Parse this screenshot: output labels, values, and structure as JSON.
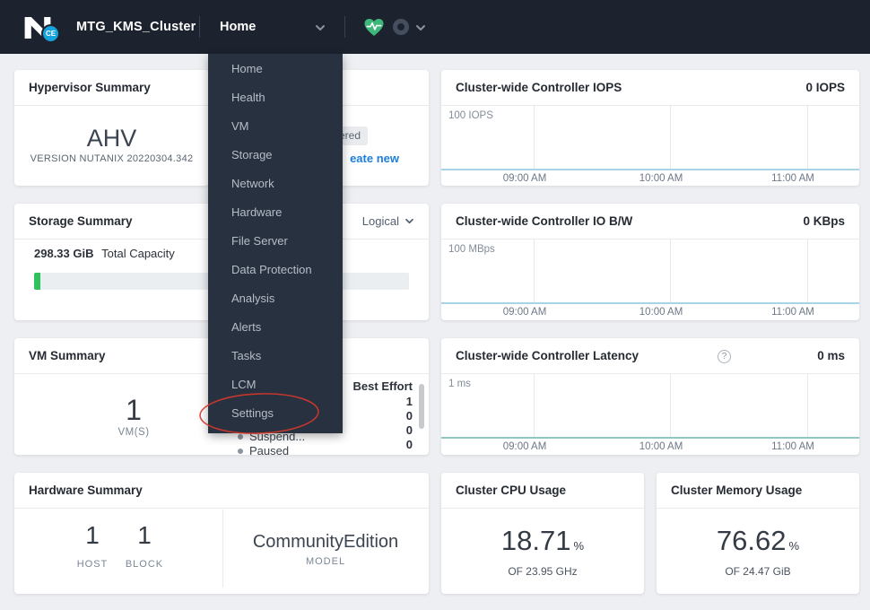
{
  "navbar": {
    "logo_badge": "CE",
    "cluster_name": "MTG_KMS_Cluster",
    "menu_label": "Home"
  },
  "menu": {
    "items": [
      "Home",
      "Health",
      "VM",
      "Storage",
      "Network",
      "Hardware",
      "File Server",
      "Data Protection",
      "Analysis",
      "Alerts",
      "Tasks",
      "LCM",
      "Settings"
    ]
  },
  "annotation": {
    "shape": "ellipse-around-settings",
    "color": "#d5382c"
  },
  "hypervisor": {
    "title": "Hypervisor Summary",
    "name": "AHV",
    "version": "VERSION NUTANIX 20220304.342"
  },
  "prism_central": {
    "badge_visible_fragment": "ered",
    "link_visible_fragment": "eate new",
    "link_color": "#1d7ed9"
  },
  "storage": {
    "title": "Storage Summary",
    "view_selector": "Logical",
    "total_capacity_value": "298.33 GiB",
    "total_capacity_label": "Total Capacity",
    "bar_fill_color": "#2fc15c"
  },
  "vm": {
    "title": "VM Summary",
    "count": "1",
    "count_label": "VM(S)",
    "legend_header": "Best Effort",
    "legend_values": [
      "1",
      "0",
      "0",
      "0"
    ],
    "visible_legend_labels": [
      "Suspend...",
      "Paused"
    ]
  },
  "hardware": {
    "title": "Hardware Summary",
    "host_count": "1",
    "host_label": "HOST",
    "block_count": "1",
    "block_label": "BLOCK",
    "model_name": "CommunityEdition",
    "model_label": "MODEL"
  },
  "cpu": {
    "title": "Cluster CPU Usage",
    "value": "18.71",
    "unit": "%",
    "subtitle": "OF 23.95 GHz"
  },
  "memory": {
    "title": "Cluster Memory Usage",
    "value": "76.62",
    "unit": "%",
    "subtitle": "OF 24.47 GiB"
  },
  "charts": {
    "iops": {
      "type": "line",
      "title": "Cluster-wide Controller IOPS",
      "current": "0 IOPS",
      "y_max": "100 IOPS",
      "x_ticks": [
        "09:00 AM",
        "10:00 AM",
        "11:00 AM"
      ],
      "series_value": 0,
      "line_color": "#a9d4e6"
    },
    "io_bw": {
      "type": "line",
      "title": "Cluster-wide Controller IO B/W",
      "current": "0 KBps",
      "y_max": "100 MBps",
      "x_ticks": [
        "09:00 AM",
        "10:00 AM",
        "11:00 AM"
      ],
      "series_value": 0,
      "line_color": "#a9d4e6"
    },
    "latency": {
      "type": "line",
      "title": "Cluster-wide Controller Latency",
      "current": "0 ms",
      "y_max": "1 ms",
      "x_ticks": [
        "09:00 AM",
        "10:00 AM",
        "11:00 AM"
      ],
      "series_value": 0,
      "line_color": "#8fc8c2",
      "help_glyph": "?"
    }
  }
}
